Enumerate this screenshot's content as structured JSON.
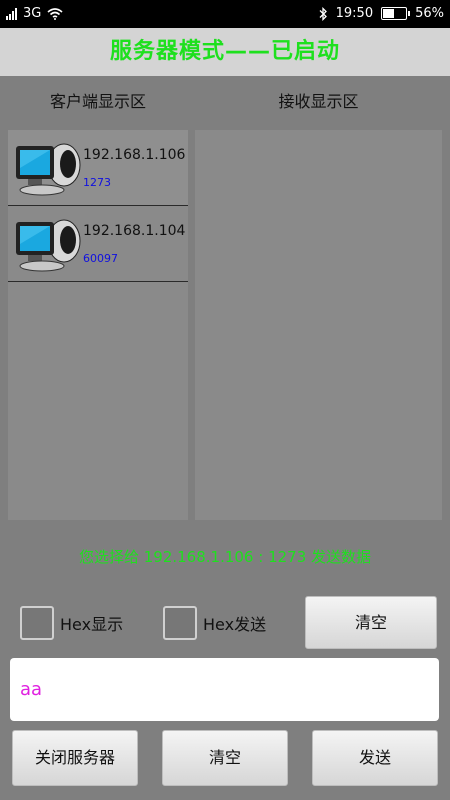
{
  "status_bar": {
    "network_type": "3G",
    "time": "19:50",
    "battery_percent": "56%",
    "battery_level": 0.56,
    "icons": [
      "signal-icon",
      "wifi-icon",
      "bluetooth-icon",
      "battery-icon"
    ]
  },
  "title": "服务器模式——已启动",
  "colors": {
    "title": "#1ee01e",
    "port": "#1010e0",
    "input_text": "#e020e0",
    "background": "#7f7f7f"
  },
  "client_panel": {
    "header": "客户端显示区",
    "clients": [
      {
        "ip": "192.168.1.106",
        "port": "1273"
      },
      {
        "ip": "192.168.1.104",
        "port": "60097"
      }
    ]
  },
  "receive_panel": {
    "header": "接收显示区"
  },
  "selection_info": "您选择给 192.168.1.106 : 1273 发送数据",
  "options": {
    "hex_display_label": "Hex显示",
    "hex_send_label": "Hex发送",
    "hex_display_checked": false,
    "hex_send_checked": false
  },
  "clear_receive_label": "清空",
  "message_input": {
    "value": "aa"
  },
  "bottom_buttons": {
    "close_server": "关闭服务器",
    "clear": "清空",
    "send": "发送"
  }
}
